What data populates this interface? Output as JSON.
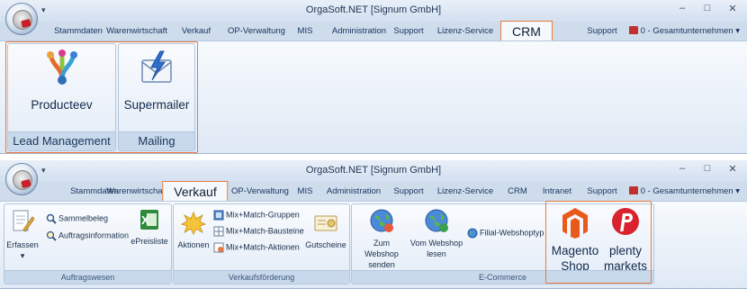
{
  "window_title": "OrgaSoft.NET [Signum GmbH]",
  "qat_icon": "dropdown-arrow-icon",
  "window_buttons": [
    "–",
    "□",
    "✕"
  ],
  "company": "0 - Gesamtunternehmen",
  "tabs": [
    "Stammdaten",
    "Warenwirtschaft",
    "Verkauf",
    "OP-Verwaltung",
    "MIS",
    "Administration",
    "Support",
    "Lizenz-Service",
    "CRM",
    "Intranet",
    "Support"
  ],
  "crm_ribbon": {
    "active_tab": "CRM",
    "groups": [
      {
        "label": "Lead Management",
        "button": "Producteev",
        "icon": "producteev-icon"
      },
      {
        "label": "Mailing",
        "button": "Supermailer",
        "icon": "supermailer-icon"
      }
    ]
  },
  "verkauf_ribbon": {
    "active_tab": "Verkauf",
    "auftragswesen": {
      "label": "Auftragswesen",
      "erfassen": "Erfassen",
      "sammelbeleg": "Sammelbeleg",
      "auftragsinformation": "Auftragsinformation",
      "epreisliste": "ePreisliste"
    },
    "verkaufsfoerderung": {
      "label": "Verkaufsförderung",
      "aktionen": "Aktionen",
      "mm_gruppen": "Mix+Match-Gruppen",
      "mm_bausteine": "Mix+Match-Bausteine",
      "mm_aktionen": "Mix+Match-Aktionen",
      "gutscheine": "Gutscheine"
    },
    "ecommerce": {
      "label": "E-Commerce",
      "zum_webshop_1": "Zum Webshop",
      "zum_webshop_2": "senden",
      "vom_webshop_1": "Vom Webshop",
      "vom_webshop_2": "lesen",
      "filial": "Filial-Webshoptyp",
      "magento_1": "Magento",
      "magento_2": "Shop",
      "plenty_1": "plenty",
      "plenty_2": "markets"
    }
  },
  "colors": {
    "highlight": "#e87a3c",
    "ribbon_bg": "#cfdcec",
    "magento": "#e8591a",
    "plenty": "#d9232e"
  }
}
